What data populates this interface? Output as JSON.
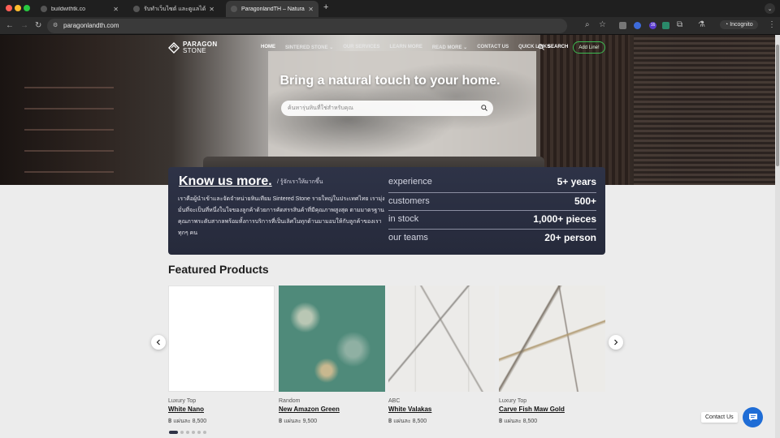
{
  "browser": {
    "tabs": [
      {
        "label": "buildwithtk.co"
      },
      {
        "label": "รับทำเว็บไซต์ และดูแลได้ทุกรูปแบบ"
      },
      {
        "label": "ParagonlandTH – Natural touch"
      }
    ],
    "url": "paragonlandth.com",
    "incognito_label": "Incognito",
    "ext_badge": "16"
  },
  "site": {
    "logo": {
      "line1": "PARAGON",
      "line2": "STONE"
    },
    "nav": [
      {
        "label": "HOME"
      },
      {
        "label": "SINTERED STONE ⌄"
      },
      {
        "label": "OUR SERVICES"
      },
      {
        "label": "LEARN MORE"
      },
      {
        "label": "READ MORE ⌄"
      },
      {
        "label": "CONTACT US"
      },
      {
        "label": "QUICK LINKS"
      }
    ],
    "search_label": "SEARCH",
    "addline_label": "Add Line!"
  },
  "hero": {
    "headline": "Bring a natural touch to your home.",
    "search_placeholder": "ค้นหารุ่นหินที่ใช่สำหรับคุณ"
  },
  "about": {
    "title": "Know us more.",
    "subtitle": "/ รู้จักเราให้มากขึ้น",
    "paragraph": "เราคือผู้นำเข้าและจัดจำหน่ายหินเทียม Sintered Stone รายใหญ่ในประเทศไทย เรามุ่งมั่นที่จะเป็นที่หนึ่งในใจของลูกค้าด้วยการคัดสรรสินค้าที่มีคุณภาพสูงสุด ตามมาตรฐานคุณภาพระดับสากลพร้อมทั้งการบริการที่เป็นเลิศในทุกด้านมามอบให้กับลูกค้าของเราทุกๆ คน",
    "stats": [
      {
        "key": "experience",
        "value": "5+ years"
      },
      {
        "key": "customers",
        "value": "500+"
      },
      {
        "key": "in stock",
        "value": "1,000+ pieces"
      },
      {
        "key": "our teams",
        "value": "20+ person"
      }
    ]
  },
  "featured": {
    "title": "Featured Products",
    "products": [
      {
        "category": "Luxury Top",
        "name": "White Nano",
        "price": "฿ แผ่นละ 8,500",
        "swatch": "#ffffff"
      },
      {
        "category": "Random",
        "name": "New Amazon Green",
        "price": "฿ แผ่นละ 9,500",
        "swatch": "#4f8a7a"
      },
      {
        "category": "ABC",
        "name": "White Valakas",
        "price": "฿ แผ่นละ 8,500",
        "swatch": "#e9e8e6"
      },
      {
        "category": "Luxury Top",
        "name": "Carve Fish Maw Gold",
        "price": "฿ แผ่นละ 8,500",
        "swatch": "#ecebe8"
      }
    ]
  },
  "contact": {
    "label": "Contact Us"
  },
  "colors": {
    "accent": "#2e3347",
    "line_green": "#3dbb52",
    "chat_blue": "#1f6dd6"
  }
}
